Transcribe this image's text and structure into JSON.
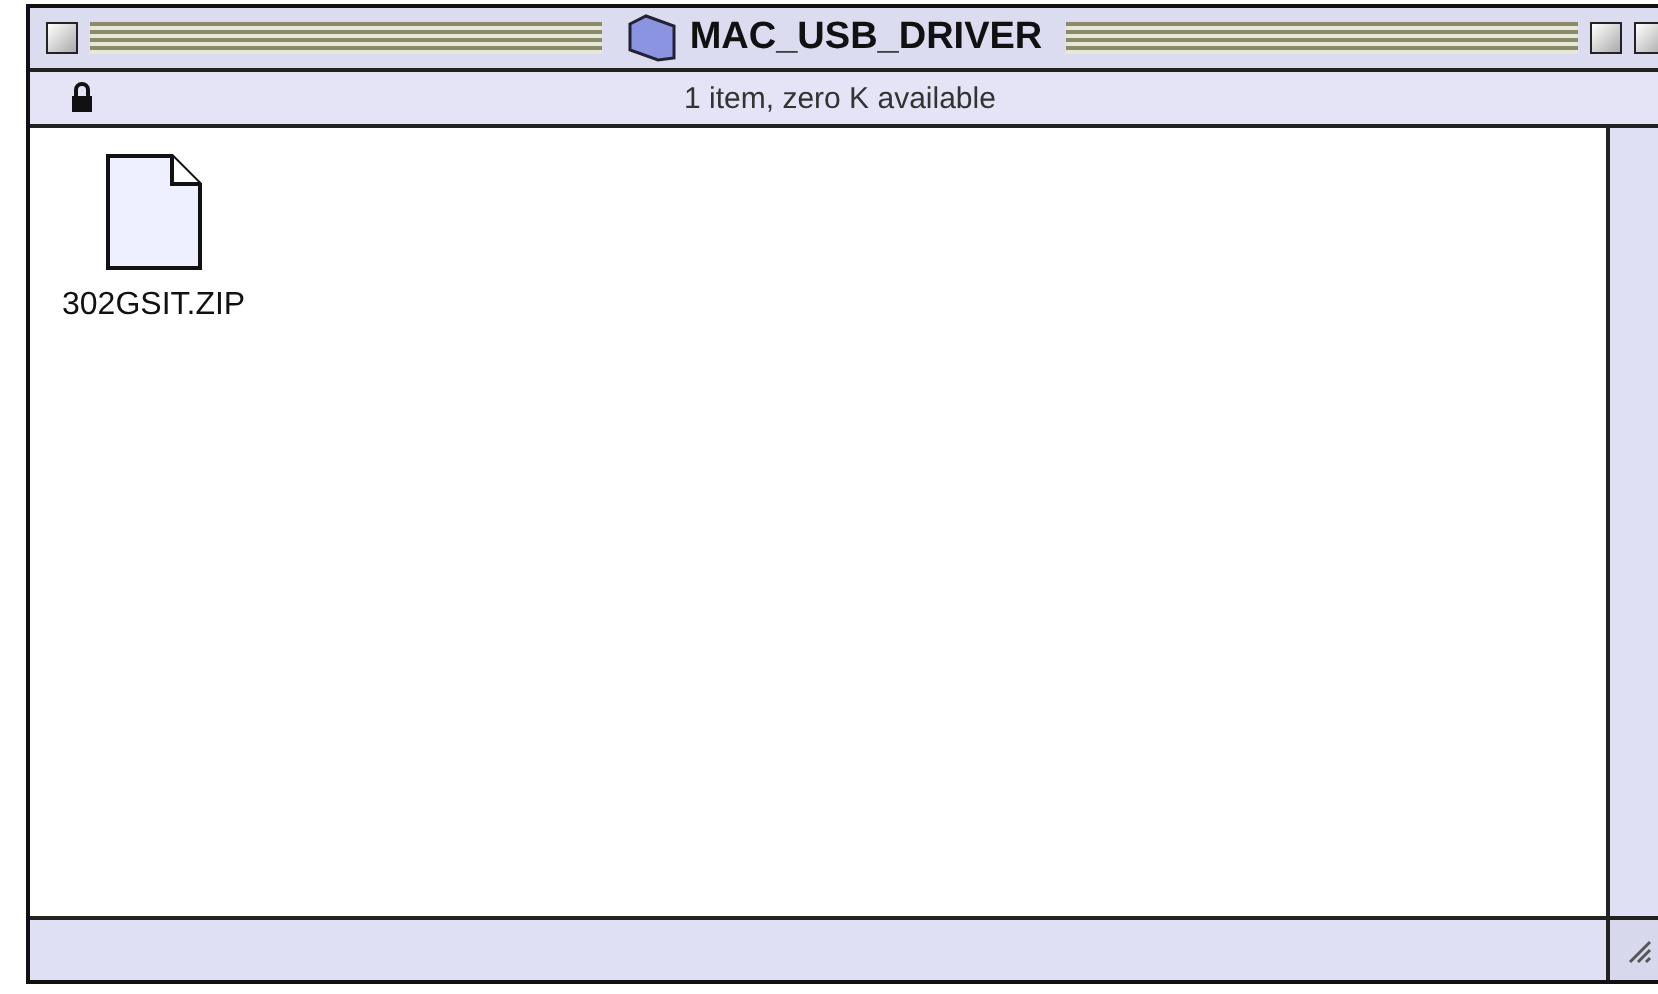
{
  "window": {
    "title": "MAC_USB_DRIVER"
  },
  "info_bar": {
    "locked": true,
    "text": "1 item, zero K available"
  },
  "items": [
    {
      "kind": "file",
      "name": "302GSIT.ZIP"
    }
  ]
}
